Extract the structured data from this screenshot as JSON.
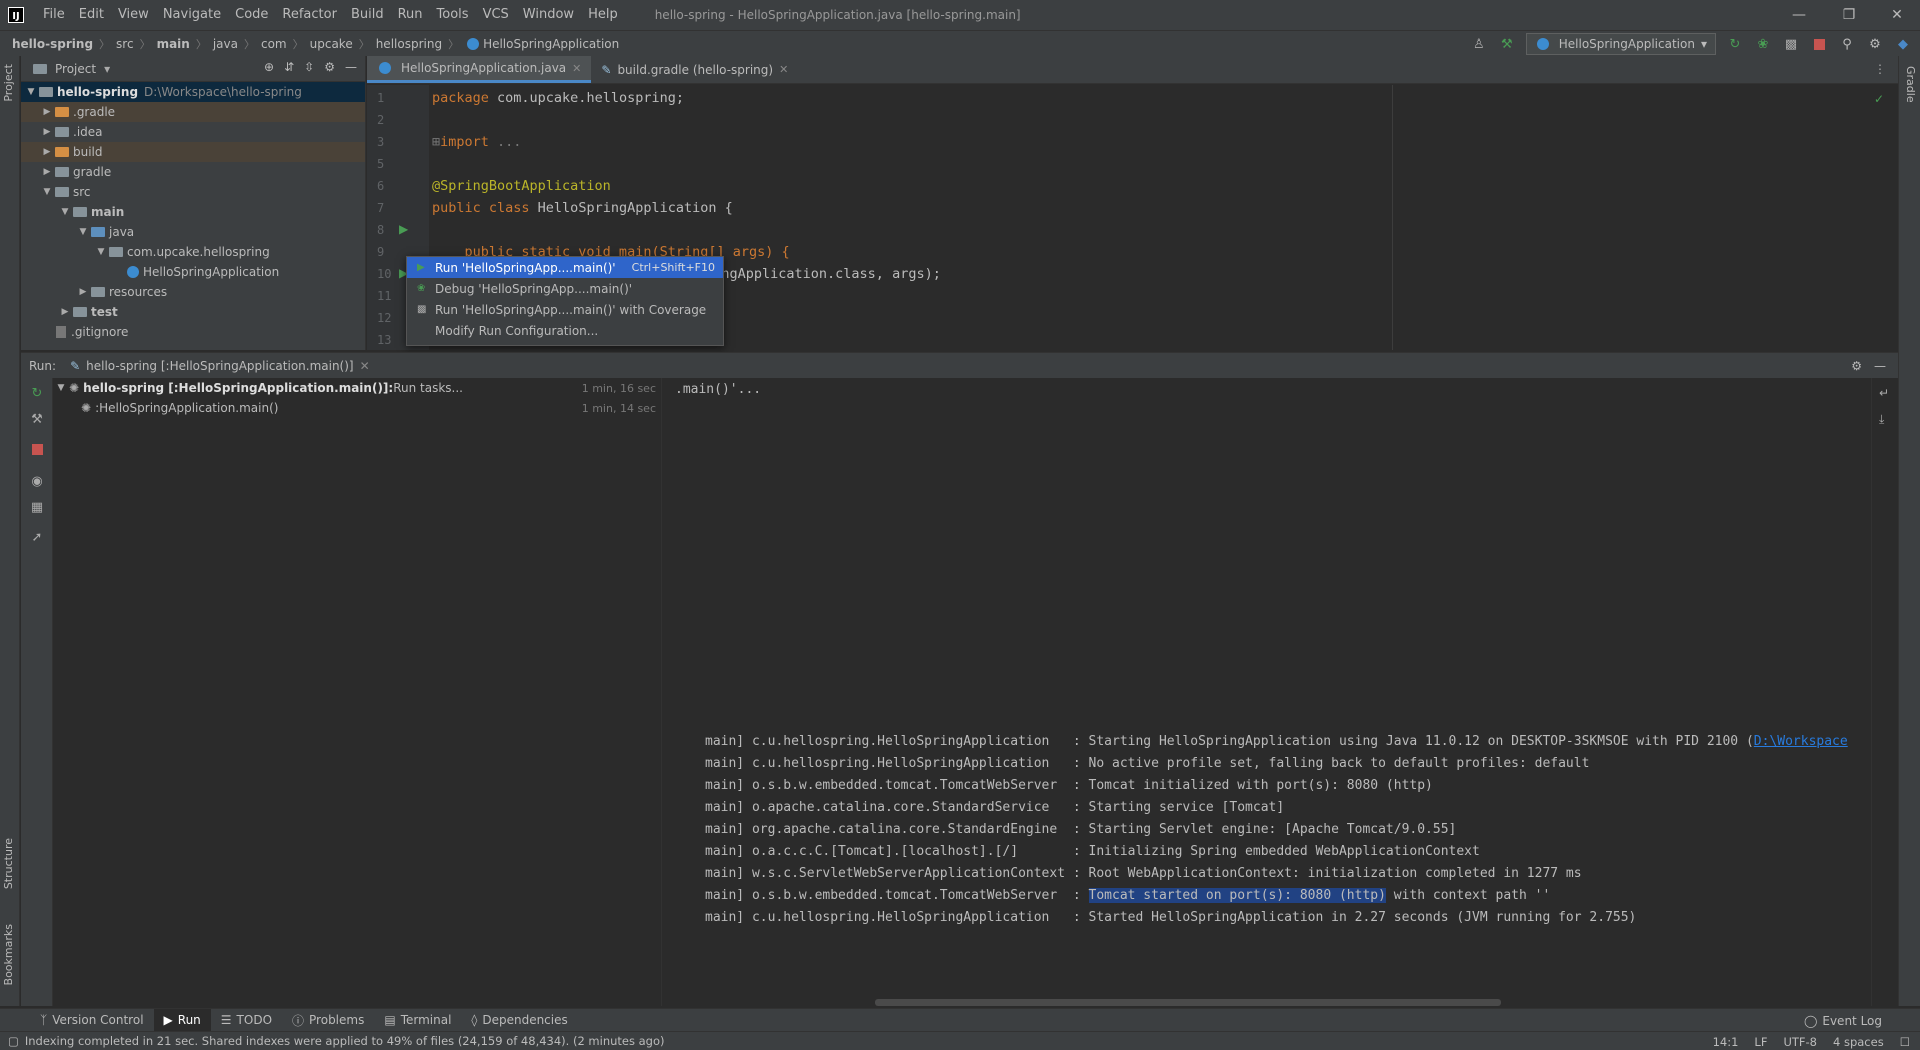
{
  "menu": [
    "File",
    "Edit",
    "View",
    "Navigate",
    "Code",
    "Refactor",
    "Build",
    "Run",
    "Tools",
    "VCS",
    "Window",
    "Help"
  ],
  "window_title": "hello-spring - HelloSpringApplication.java [hello-spring.main]",
  "breadcrumbs": [
    "hello-spring",
    "src",
    "main",
    "java",
    "com",
    "upcake",
    "hellospring",
    "HelloSpringApplication"
  ],
  "run_config": "HelloSpringApplication",
  "left_strip": {
    "project": "Project",
    "structure": "Structure",
    "bookmarks": "Bookmarks"
  },
  "right_strip": {
    "gradle": "Gradle"
  },
  "project": {
    "title": "Project",
    "tree": [
      {
        "label": "hello-spring",
        "extra": "D:\\Workspace\\hello-spring"
      },
      {
        "label": ".gradle"
      },
      {
        "label": ".idea"
      },
      {
        "label": "build"
      },
      {
        "label": "gradle"
      },
      {
        "label": "src"
      },
      {
        "label": "main"
      },
      {
        "label": "java"
      },
      {
        "label": "com.upcake.hellospring"
      },
      {
        "label": "HelloSpringApplication"
      },
      {
        "label": "resources"
      },
      {
        "label": "test"
      },
      {
        "label": ".gitignore"
      }
    ]
  },
  "editor": {
    "tabs": [
      {
        "label": "HelloSpringApplication.java"
      },
      {
        "label": "build.gradle (hello-spring)"
      }
    ],
    "lines": {
      "l1_kw": "package",
      "l1_rest": " com.upcake.hellospring;",
      "l3_kw": "import",
      "l3_rest": " ...",
      "l6_ann": "@SpringBootApplication",
      "l7_kw": "public class",
      "l7_rest": " HelloSpringApplication {",
      "l9_text": "    public static void main(String[] args) {",
      "l10_text": "pringApplication.class, args);"
    },
    "line_numbers": [
      "1",
      "2",
      "3",
      "5",
      "6",
      "7",
      "8",
      "9",
      "10",
      "11",
      "12",
      "13"
    ]
  },
  "popup": {
    "items": [
      {
        "label": "Run 'HelloSpringApp....main()'",
        "shortcut": "Ctrl+Shift+F10"
      },
      {
        "label": "Debug 'HelloSpringApp....main()'"
      },
      {
        "label": "Run 'HelloSpringApp....main()' with Coverage"
      },
      {
        "label": "Modify Run Configuration..."
      }
    ]
  },
  "run": {
    "label": "Run:",
    "tab": "hello-spring [:HelloSpringApplication.main()]",
    "tree": [
      {
        "bold": "hello-spring [:HelloSpringApplication.main()]:",
        "rest": " Run tasks...",
        "time": "1 min, 16 sec"
      },
      {
        "bold": "",
        "rest": ":HelloSpringApplication.main()",
        "time": "1 min, 14 sec"
      }
    ],
    "console_top": ".main()'...",
    "console_lines": [
      {
        "pre": "main] c.u.hellospring.HelloSpringApplication   : Starting HelloSpringApplication using Java 11.0.12 on DESKTOP-3SKMSOE with PID 2100 (",
        "link": "D:\\Workspace"
      },
      {
        "pre": "main] c.u.hellospring.HelloSpringApplication   : No active profile set, falling back to default profiles: default"
      },
      {
        "pre": "main] o.s.b.w.embedded.tomcat.TomcatWebServer  : Tomcat initialized with port(s): 8080 (http)"
      },
      {
        "pre": "main] o.apache.catalina.core.StandardService   : Starting service [Tomcat]"
      },
      {
        "pre": "main] org.apache.catalina.core.StandardEngine  : Starting Servlet engine: [Apache Tomcat/9.0.55]"
      },
      {
        "pre": "main] o.a.c.c.C.[Tomcat].[localhost].[/]       : Initializing Spring embedded WebApplicationContext"
      },
      {
        "pre": "main] w.s.c.ServletWebServerApplicationContext : Root WebApplicationContext: initialization completed in 1277 ms"
      },
      {
        "pre": "main] o.s.b.w.embedded.tomcat.TomcatWebServer  : ",
        "sel": "Tomcat started on port(s): 8080 (http)",
        "post": " with context path ''"
      },
      {
        "pre": "main] c.u.hellospring.HelloSpringApplication   : Started HelloSpringApplication in 2.27 seconds (JVM running for 2.755)"
      }
    ]
  },
  "bottom_tools": [
    "Version Control",
    "Run",
    "TODO",
    "Problems",
    "Terminal",
    "Dependencies"
  ],
  "event_log": "Event Log",
  "status": {
    "message": "Indexing completed in 21 sec. Shared indexes were applied to 49% of files (24,159 of 48,434). (2 minutes ago)",
    "position": "14:1",
    "line_sep": "LF",
    "encoding": "UTF-8",
    "indent": "4 spaces"
  },
  "colors": {
    "accent": "#4a88c7",
    "selection": "#2f65ca",
    "run_green": "#499c54",
    "stop_red": "#c75450"
  }
}
